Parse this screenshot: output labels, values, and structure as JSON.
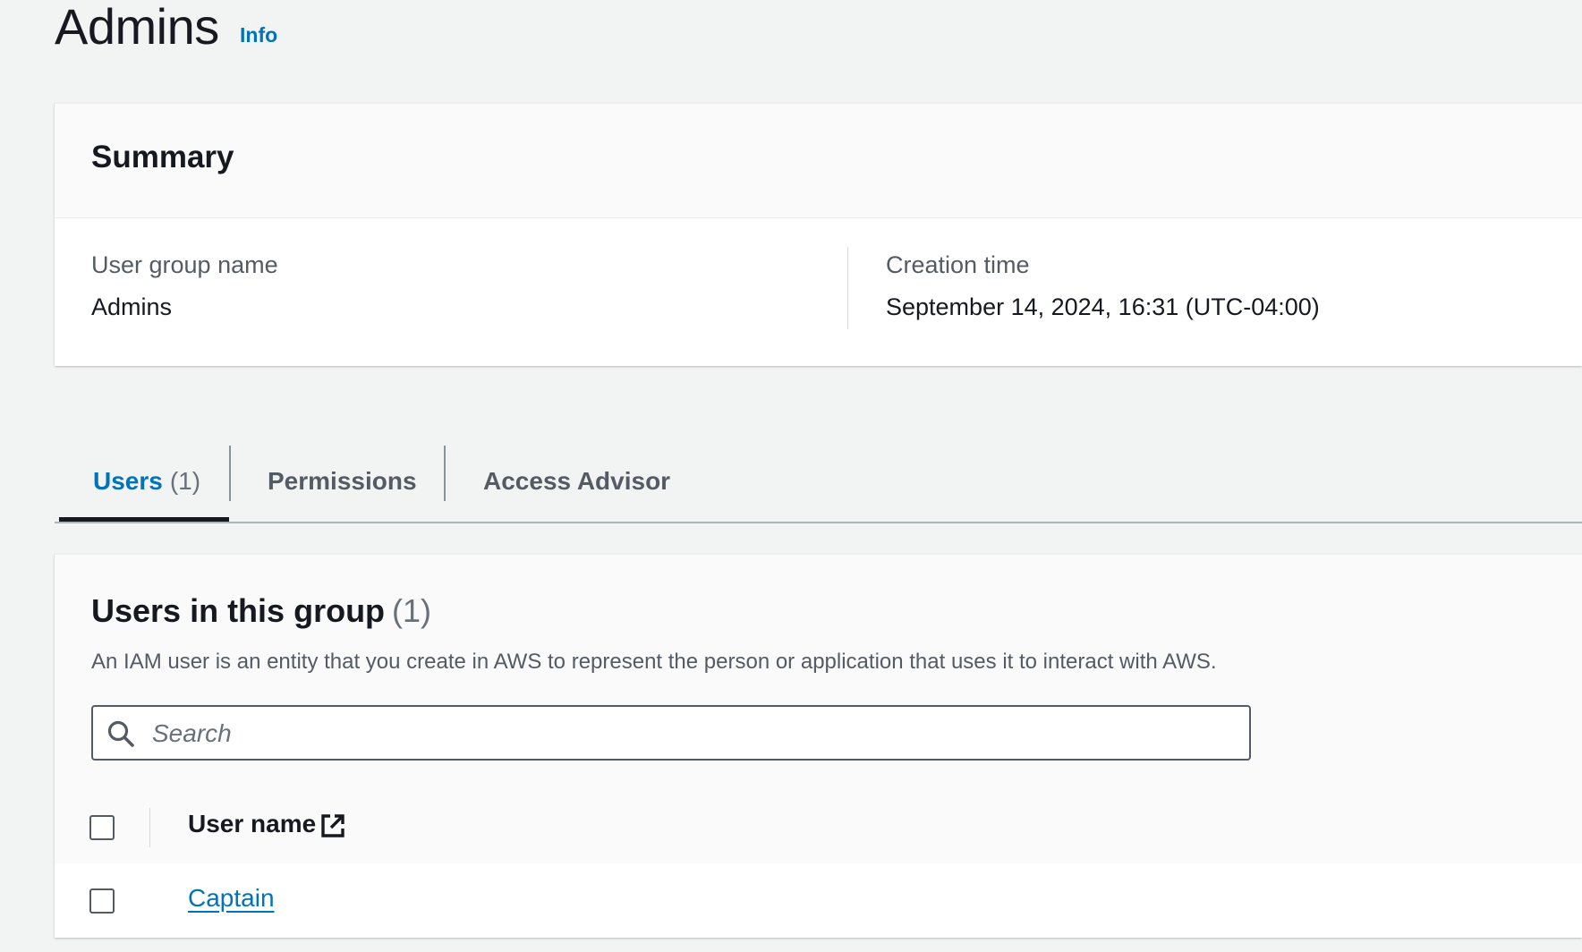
{
  "page": {
    "title": "Admins",
    "info_link": "Info"
  },
  "summary": {
    "title": "Summary",
    "fields": [
      {
        "label": "User group name",
        "value": "Admins"
      },
      {
        "label": "Creation time",
        "value": "September 14, 2024, 16:31 (UTC-04:00)"
      }
    ]
  },
  "tabs": [
    {
      "label": "Users",
      "count": "(1)",
      "active": true
    },
    {
      "label": "Permissions",
      "active": false
    },
    {
      "label": "Access Advisor",
      "active": false
    }
  ],
  "users_section": {
    "title": "Users in this group",
    "count": "(1)",
    "description": "An IAM user is an entity that you create in AWS to represent the person or application that uses it to interact with AWS.",
    "search_placeholder": "Search",
    "search_value": "",
    "column_header": "User name",
    "rows": [
      {
        "user_name": "Captain"
      }
    ]
  },
  "colors": {
    "link": "#0073bb",
    "background": "#f2f3f3",
    "panel": "#ffffff"
  }
}
